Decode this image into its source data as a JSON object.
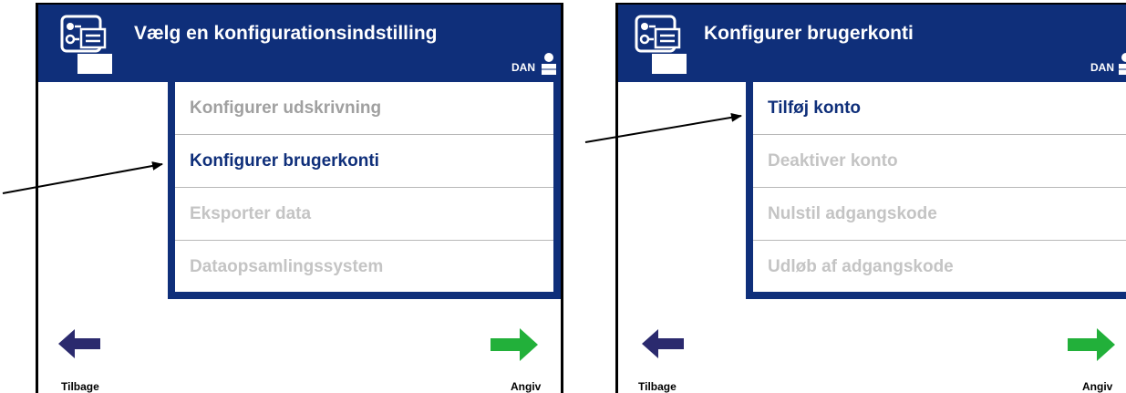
{
  "panel1": {
    "title": "Vælg en konfigurationsindstilling",
    "language": "DAN",
    "menu_items": [
      "Konfigurer udskrivning",
      "Konfigurer brugerkonti",
      "Eksporter data",
      "Dataopsamlingssystem"
    ],
    "back_label": "Tilbage",
    "enter_label": "Angiv"
  },
  "panel2": {
    "title": "Konfigurer brugerkonti",
    "language": "DAN",
    "menu_items": [
      "Tilføj konto",
      "Deaktiver konto",
      "Nulstil adgangskode",
      "Udløb af adgangskode"
    ],
    "back_label": "Tilbage",
    "enter_label": "Angiv"
  },
  "colors": {
    "header": "#0f2f7a",
    "selected_text": "#0f2f7a",
    "disabled_text": "#c4c4c4",
    "dim_text": "#a0a0a0",
    "back_arrow": "#2b2a6e",
    "forward_arrow": "#22b03a"
  }
}
